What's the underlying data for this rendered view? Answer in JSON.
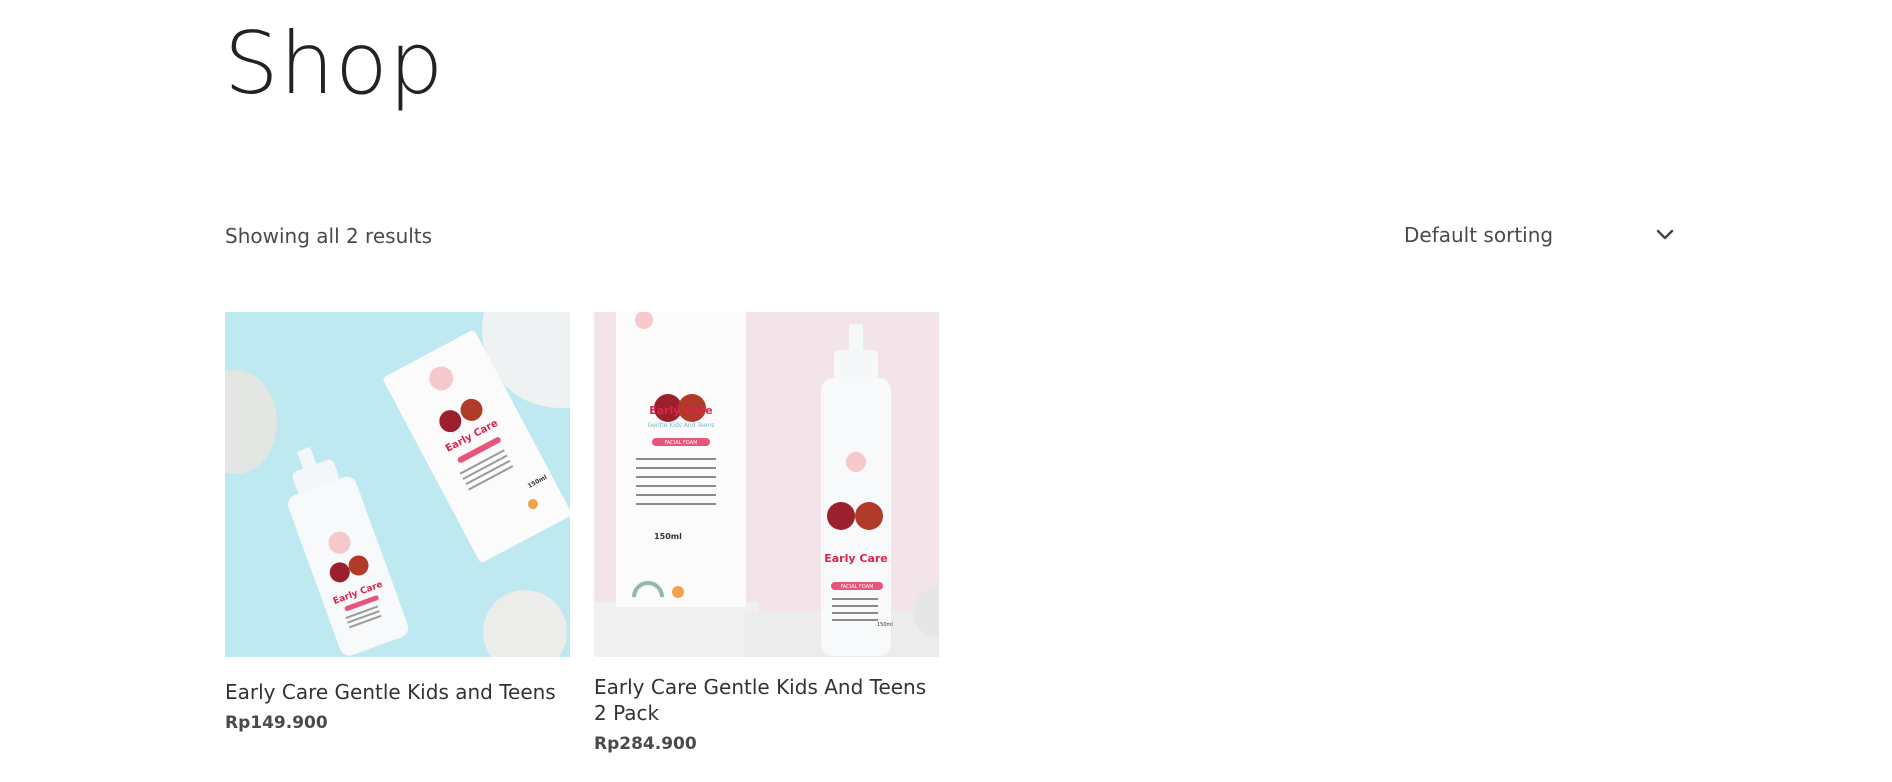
{
  "page": {
    "title": "Shop"
  },
  "toolbar": {
    "result_count": "Showing all 2 results",
    "sorting": {
      "selected": "Default sorting",
      "icon": "chevron-down-icon"
    }
  },
  "products": [
    {
      "name": "Early Care Gentle Kids and Teens",
      "price": "Rp149.900",
      "image_background": "#bfe9f0"
    },
    {
      "name": "Early Care Gentle Kids And Teens 2 Pack",
      "price": "Rp284.900",
      "image_background": "#f3e4ea"
    }
  ],
  "product_packaging": {
    "brand": "Early Care",
    "subtitle": "Gentle Kids And Teens",
    "variant": "FACIAL FOAM",
    "volume": "150ml"
  },
  "colors": {
    "text_dark": "#222222",
    "text_muted": "#4a4a4a",
    "brand_red": "#d9254b",
    "label_pink": "#e8557a"
  }
}
